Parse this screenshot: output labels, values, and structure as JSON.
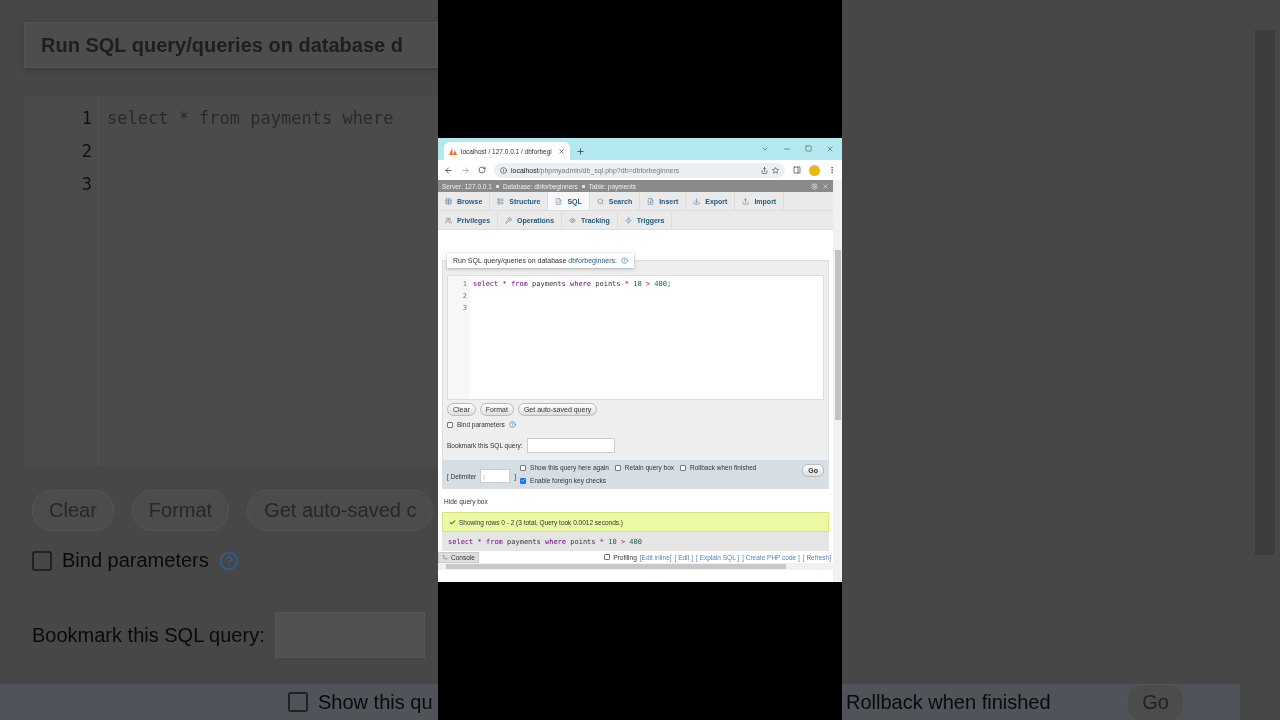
{
  "backdrop": {
    "heading": "Run SQL query/queries on database d",
    "line_numbers": [
      "1",
      "2",
      "3"
    ],
    "code": "select * from payments where",
    "buttons": [
      "Clear",
      "Format",
      "Get auto-saved c"
    ],
    "bind_parameters": {
      "label": "Bind parameters",
      "checked": false
    },
    "bookmark_label": "Bookmark this SQL query:",
    "show_query": {
      "label": "Show this qu",
      "checked": false
    },
    "rollback_label": "Rollback when finished",
    "go_button": "Go"
  },
  "browser": {
    "tab_title": "localhost / 127.0.0.1 / dbforbegi",
    "url_host": "localhost",
    "url_path": "/phpmyadmin/db_sql.php?db=dbforbeginners"
  },
  "breadcrumb": [
    "Server: 127.0.0.1",
    "Database: dbforbeginners",
    "Table: payments"
  ],
  "tabs": [
    {
      "label": "Browse",
      "selected": false
    },
    {
      "label": "Structure",
      "selected": false
    },
    {
      "label": "SQL",
      "selected": true
    },
    {
      "label": "Search",
      "selected": false
    },
    {
      "label": "Insert",
      "selected": false
    },
    {
      "label": "Export",
      "selected": false
    },
    {
      "label": "Import",
      "selected": false
    }
  ],
  "tabs_row_2": [
    {
      "label": "Privileges",
      "selected": false
    },
    {
      "label": "Operations",
      "selected": false
    },
    {
      "label": "Tracking",
      "selected": false
    },
    {
      "label": "Triggers",
      "selected": false
    }
  ],
  "query_box": {
    "heading": "Run SQL query/queries on database **dbforbeginners**:",
    "line_numbers": [
      "1",
      "2",
      "3"
    ],
    "code": [
      {
        "text": "select",
        "kind": "keyword"
      },
      {
        "text": "*",
        "kind": "operator"
      },
      {
        "text": "from",
        "kind": "keyword"
      },
      {
        "text": "payments",
        "kind": "name"
      },
      {
        "text": "where",
        "kind": "keyword"
      },
      {
        "text": "points",
        "kind": "name"
      },
      {
        "text": "*",
        "kind": "operator"
      },
      {
        "text": "10",
        "kind": "number"
      },
      {
        "text": ">",
        "kind": "operator"
      },
      {
        "text": "400;",
        "kind": "number"
      }
    ],
    "buttons": [
      "Clear",
      "Format",
      "Get auto-saved query"
    ],
    "bind_parameters": {
      "label": "Bind parameters",
      "checked": false
    },
    "bookmark_label": "Bookmark this SQL query:",
    "delimiter_label": "[ Delimiter",
    "delimiter_value": ";",
    "delimiter_close": "]",
    "options": [
      {
        "label": "Show this query here again",
        "checked": false
      },
      {
        "label": "Retain query box",
        "checked": false
      },
      {
        "label": "Rollback when finished",
        "checked": false
      },
      {
        "label": "Enable foreign key checks",
        "checked": true
      }
    ],
    "go_button": "Go"
  },
  "hide_query_box": "Hide query box",
  "success_message": "Showing rows 0 - 2 (3 total, Query took 0.0012 seconds.)",
  "result_query": [
    {
      "text": "select",
      "kind": "keyword"
    },
    {
      "text": "*",
      "kind": "operator"
    },
    {
      "text": "from",
      "kind": "keyword"
    },
    {
      "text": "payments",
      "kind": "name"
    },
    {
      "text": "where",
      "kind": "keyword"
    },
    {
      "text": "points",
      "kind": "name"
    },
    {
      "text": "*",
      "kind": "operator"
    },
    {
      "text": "10",
      "kind": "number"
    },
    {
      "text": ">",
      "kind": "operator"
    },
    {
      "text": "400",
      "kind": "number"
    }
  ],
  "console": "Console",
  "profiling": {
    "label": "Profiling",
    "checked": false
  },
  "result_links": [
    "[Edit inline]",
    "[ Edit ]",
    "[ Explain SQL ]",
    "[ Create PHP code ]",
    "[ Refresh]"
  ]
}
